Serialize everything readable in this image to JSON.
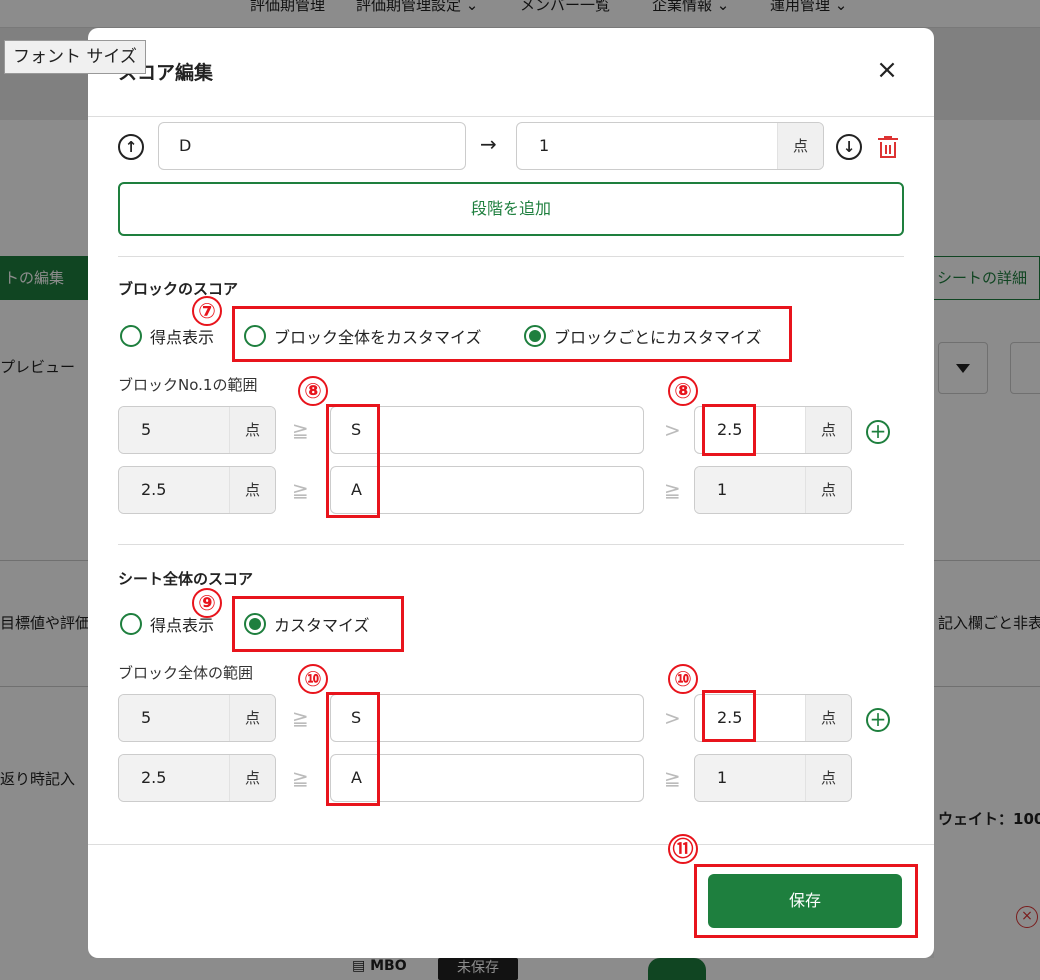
{
  "background": {
    "top_nav": [
      "評価期管理",
      "評価期管理設定 ⌄",
      "メンバー一覧",
      "企業情報 ⌄",
      "運用管理 ⌄"
    ],
    "left_tab": "トの編集",
    "right_tab": "シートの詳細",
    "preview": "プレビュー",
    "left_hint": "目標値や評価",
    "right_hint": "記入欄ごと非表",
    "review_hint": "返り時記入",
    "weight": "ウェイト：100",
    "bottom_mbo": "MBO",
    "bottom_badge": "未保存"
  },
  "font_size_tooltip": "フォント サイズ",
  "modal": {
    "title": "スコア編集",
    "close_icon": "×",
    "top_row": {
      "grade": "D",
      "score": "1",
      "unit": "点"
    },
    "add_level_label": "段階を追加",
    "block_score": {
      "title": "ブロックのスコア",
      "options": [
        "得点表示",
        "ブロック全体をカスタマイズ",
        "ブロックごとにカスタマイズ"
      ],
      "selected_index": 2,
      "range_label": "ブロックNo.1の範囲",
      "rows": [
        {
          "min": "5",
          "unit": "点",
          "op1": "≧",
          "grade": "S",
          "op2": ">",
          "max": "2.5"
        },
        {
          "min": "2.5",
          "unit": "点",
          "op1": "≧",
          "grade": "A",
          "op2": "≧",
          "max": "1"
        }
      ]
    },
    "sheet_score": {
      "title": "シート全体のスコア",
      "options": [
        "得点表示",
        "カスタマイズ"
      ],
      "selected_index": 1,
      "range_label": "ブロック全体の範囲",
      "rows": [
        {
          "min": "5",
          "unit": "点",
          "op1": "≧",
          "grade": "S",
          "op2": ">",
          "max": "2.5"
        },
        {
          "min": "2.5",
          "unit": "点",
          "op1": "≧",
          "grade": "A",
          "op2": "≧",
          "max": "1"
        }
      ]
    },
    "save_label": "保存"
  },
  "annotations": [
    "⑦",
    "⑧",
    "⑧",
    "⑨",
    "⑩",
    "⑩",
    "⑪"
  ],
  "colors": {
    "accent": "#1e7f3e",
    "annotation": "#e8141c",
    "danger": "#d33333"
  }
}
